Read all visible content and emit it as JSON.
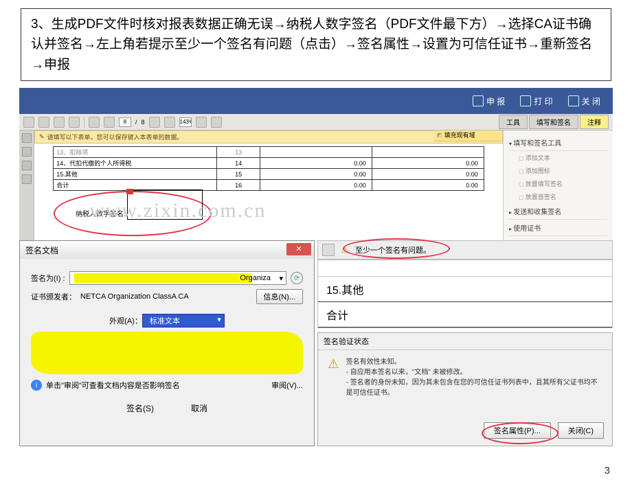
{
  "instruction": "3、生成PDF文件时核对报表数据正确无误→纳税人数字签名（PDF文件最下方）→选择CA证书确认并签名→左上角若提示至少一个签名有问题（点击）→签名属性→设置为可信任证书→重新签名→申报",
  "top_buttons": {
    "declare": "申 报",
    "print": "打 印",
    "close": "关 闭"
  },
  "pdf_toolbar": {
    "page_current": "8",
    "page_sep": "/",
    "page_total": "8",
    "zoom": "143%",
    "tabs": {
      "tools": "工具",
      "fill_sign": "填写和签名",
      "comment": "注释"
    }
  },
  "hint": "请填写以下表单。您可以保存键入本表单的数据。",
  "form_area_label": "填充现有域",
  "pdf_table": {
    "rows": [
      {
        "label": "13、扣除项",
        "num": "13",
        "v1": "",
        "v2": ""
      },
      {
        "label": "14、代扣代缴的个人所得税",
        "num": "14",
        "v1": "0.00",
        "v2": "0.00"
      },
      {
        "label": "15.其他",
        "num": "15",
        "v1": "0.00",
        "v2": "0.00"
      },
      {
        "label": "合计",
        "num": "16",
        "v1": "0.00",
        "v2": "0.00"
      }
    ]
  },
  "sign_label": "纳税人数字签名:",
  "watermark": "www.zixin.com.cn",
  "right_panel": {
    "grp1": "填写和签名工具",
    "items": [
      "添加文本",
      "添加图标",
      "放置填写签名",
      "放置首签名"
    ],
    "grp2": "发送和收集签名",
    "grp3": "使用证书"
  },
  "dlg_sign": {
    "title": "签名文档",
    "sign_as_label": "签名为(I) :",
    "sign_as_value": "Organiza",
    "issuer_label": "证书颁发者：",
    "issuer_value": "NETCA Organization ClassA CA",
    "info_btn": "信息(N)...",
    "appearance_label": "外观(A)：",
    "appearance_value": "标准文本",
    "review_hint": "单击\"审阅\"可查看文档内容是否影响签名",
    "review_btn": "审阅(V)...",
    "sign_btn": "签名(S)",
    "cancel_btn": "取消"
  },
  "warn_bar": "至少一个签名有问题。",
  "mini_table": {
    "r1": "15.其他",
    "r2": "合计"
  },
  "verify": {
    "title": "签名验证状态",
    "line1": "签名有效性未知。",
    "line2": "- 自应用本签名以来，\"文档\" 未被修改。",
    "line3": "- 签名者的身份未知，因为其未包含在您的可信任证书列表中，且其所有父证书均不是可信任证书。",
    "prop_btn": "签名属性(P)...",
    "close_btn": "关闭(C)"
  },
  "slide_num": "3"
}
